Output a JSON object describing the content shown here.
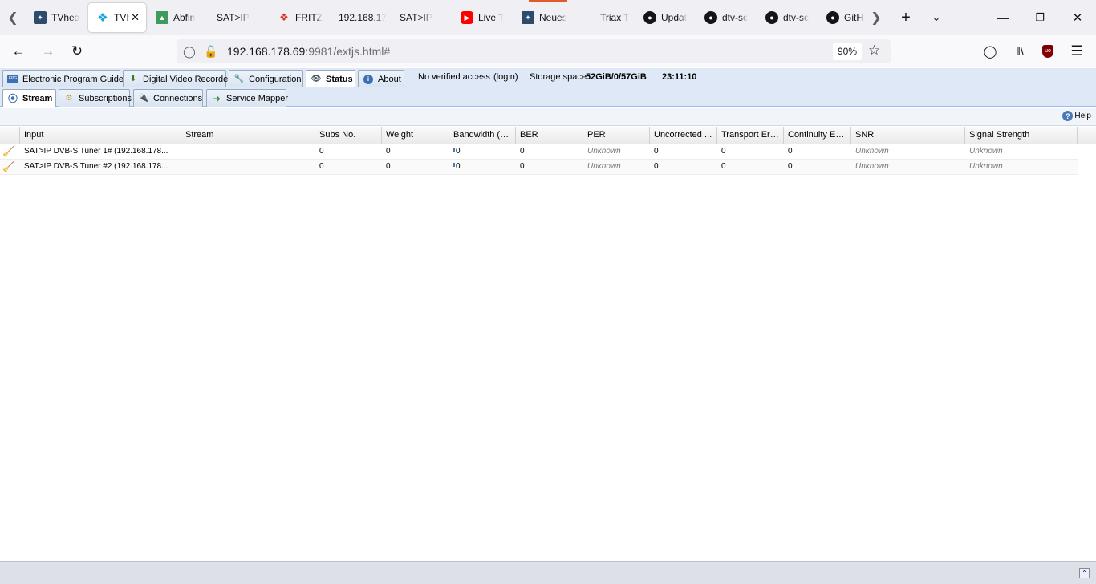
{
  "browser": {
    "tabs": [
      {
        "title": "TVhea",
        "favicon": "tvheadend-icon",
        "active": false
      },
      {
        "title": "TVh",
        "favicon": "kodi-icon",
        "active": true
      },
      {
        "title": "Abfin",
        "favicon": "triangle-icon",
        "active": false
      },
      {
        "title": "SAT>IP",
        "favicon": "none",
        "active": false
      },
      {
        "title": "FRITZ",
        "favicon": "fritz-icon",
        "active": false
      },
      {
        "title": "192.168.17",
        "favicon": "none",
        "active": false
      },
      {
        "title": "SAT>IP",
        "favicon": "none",
        "active": false
      },
      {
        "title": "Live T",
        "favicon": "youtube-icon",
        "active": false
      },
      {
        "title": "Neues",
        "favicon": "tvheadend-icon",
        "active": false
      },
      {
        "title": "Triax T",
        "favicon": "none",
        "active": false
      },
      {
        "title": "Updat",
        "favicon": "github-icon",
        "active": false
      },
      {
        "title": "dtv-sc",
        "favicon": "github-icon",
        "active": false
      },
      {
        "title": "dtv-sc",
        "favicon": "github-icon",
        "active": false
      },
      {
        "title": "GitH",
        "favicon": "github-icon",
        "active": false
      }
    ],
    "url_host": "192.168.178.69",
    "url_rest": ":9981/extjs.html#",
    "zoom": "90%"
  },
  "app": {
    "main_tabs": [
      {
        "label": "Electronic Program Guide",
        "icon": "epg-icon"
      },
      {
        "label": "Digital Video Recorder",
        "icon": "recorder-icon"
      },
      {
        "label": "Configuration",
        "icon": "wrench-icon"
      },
      {
        "label": "Status",
        "icon": "eye-icon",
        "active": true
      },
      {
        "label": "About",
        "icon": "info-icon"
      }
    ],
    "access_text": "No verified access",
    "login_text": "(login)",
    "storage_label": "Storage space:",
    "storage_value": "52GiB/0/57GiB",
    "clock": "23:11:10",
    "sub_tabs": [
      {
        "label": "Stream",
        "icon": "stream-icon",
        "active": true
      },
      {
        "label": "Subscriptions",
        "icon": "subscriptions-icon"
      },
      {
        "label": "Connections",
        "icon": "connections-icon"
      },
      {
        "label": "Service Mapper",
        "icon": "arrow-right-icon"
      }
    ],
    "help_label": "Help"
  },
  "grid": {
    "columns": [
      "Input",
      "Stream",
      "Subs No.",
      "Weight",
      "Bandwidth (k...",
      "BER",
      "PER",
      "Uncorrected ...",
      "Transport Errors",
      "Continuity Err...",
      "SNR",
      "Signal Strength"
    ],
    "rows": [
      {
        "input": "SAT>IP DVB-S Tuner 1# (192.168.178...",
        "stream": "",
        "subs": "0",
        "weight": "0",
        "bandwidth": "0",
        "ber": "0",
        "per": "Unknown",
        "uncorrected": "0",
        "transport": "0",
        "continuity": "0",
        "snr": "Unknown",
        "signal": "Unknown"
      },
      {
        "input": "SAT>IP DVB-S Tuner #2 (192.168.178...",
        "stream": "",
        "subs": "0",
        "weight": "0",
        "bandwidth": "0",
        "ber": "0",
        "per": "Unknown",
        "uncorrected": "0",
        "transport": "0",
        "continuity": "0",
        "snr": "Unknown",
        "signal": "Unknown"
      }
    ]
  }
}
